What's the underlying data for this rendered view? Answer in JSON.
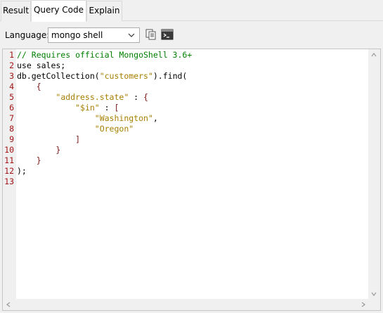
{
  "tabs": [
    {
      "label": "Result",
      "active": false
    },
    {
      "label": "Query Code",
      "active": true
    },
    {
      "label": "Explain",
      "active": false
    }
  ],
  "toolbar": {
    "language_label": "Language:",
    "language_value": "mongo shell",
    "icons": [
      "copy-icon",
      "terminal-icon"
    ]
  },
  "editor": {
    "line_numbers": [
      "1",
      "2",
      "3",
      "4",
      "5",
      "6",
      "7",
      "8",
      "9",
      "10",
      "11",
      "12",
      "13"
    ],
    "lines": [
      [
        {
          "t": "cmt",
          "v": "// Requires official MongoShell 3.6+"
        }
      ],
      [
        {
          "t": "kw",
          "v": "use sales;"
        }
      ],
      [
        {
          "t": "kw",
          "v": "db.getCollection("
        },
        {
          "t": "str",
          "v": "\"customers\""
        },
        {
          "t": "kw",
          "v": ").find("
        }
      ],
      [
        {
          "t": "kw",
          "v": "    "
        },
        {
          "t": "brk",
          "v": "{"
        }
      ],
      [
        {
          "t": "kw",
          "v": "        "
        },
        {
          "t": "str",
          "v": "\"address.state\""
        },
        {
          "t": "kw",
          "v": " : "
        },
        {
          "t": "brk",
          "v": "{"
        }
      ],
      [
        {
          "t": "kw",
          "v": "            "
        },
        {
          "t": "str",
          "v": "\"$in\""
        },
        {
          "t": "kw",
          "v": " : "
        },
        {
          "t": "brk",
          "v": "["
        }
      ],
      [
        {
          "t": "kw",
          "v": "                "
        },
        {
          "t": "str",
          "v": "\"Washington\""
        },
        {
          "t": "kw",
          "v": ","
        }
      ],
      [
        {
          "t": "kw",
          "v": "                "
        },
        {
          "t": "str",
          "v": "\"Oregon\""
        }
      ],
      [
        {
          "t": "kw",
          "v": "            "
        },
        {
          "t": "brk",
          "v": "]"
        }
      ],
      [
        {
          "t": "kw",
          "v": "        "
        },
        {
          "t": "brk",
          "v": "}"
        }
      ],
      [
        {
          "t": "kw",
          "v": "    "
        },
        {
          "t": "brk",
          "v": "}"
        }
      ],
      [
        {
          "t": "kw",
          "v": ");"
        }
      ],
      []
    ]
  }
}
